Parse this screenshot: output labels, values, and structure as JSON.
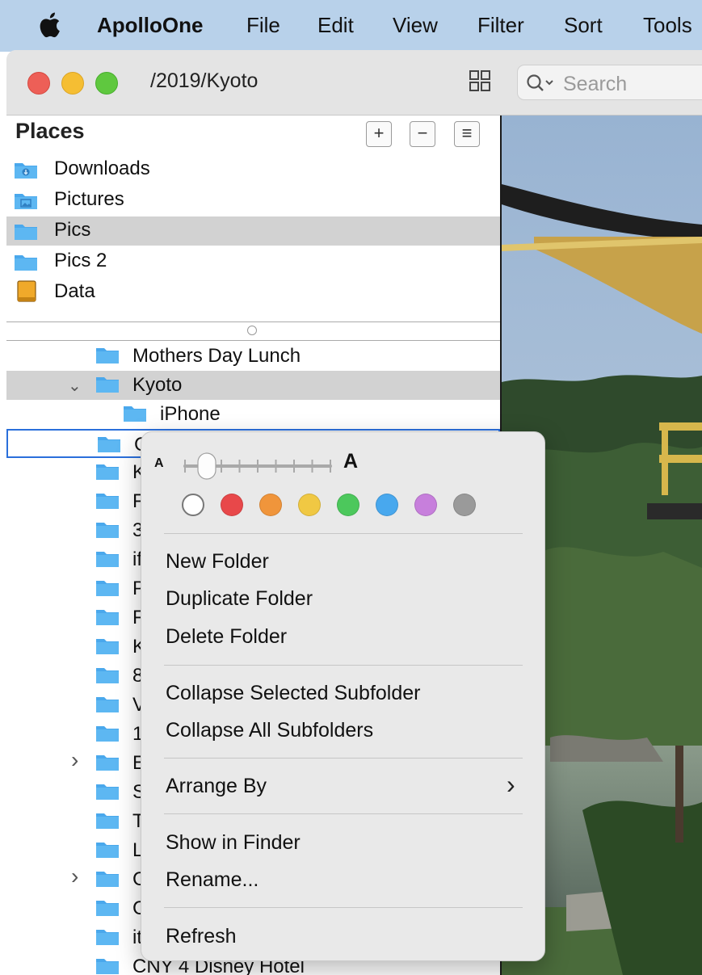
{
  "menubar": {
    "app_name": "ApolloOne",
    "items": [
      "File",
      "Edit",
      "View",
      "Filter",
      "Sort",
      "Tools"
    ]
  },
  "window": {
    "path": "/2019/Kyoto",
    "search_placeholder": "Search"
  },
  "places": {
    "title": "Places",
    "buttons": {
      "add": "+",
      "remove": "−",
      "list": "≡"
    },
    "items": [
      {
        "label": "Downloads",
        "icon": "downloads-folder-icon"
      },
      {
        "label": "Pictures",
        "icon": "pictures-folder-icon"
      },
      {
        "label": "Pics",
        "icon": "folder-icon",
        "selected": true
      },
      {
        "label": "Pics 2",
        "icon": "folder-icon"
      },
      {
        "label": "Data",
        "icon": "drive-icon"
      }
    ]
  },
  "tree": {
    "rows": [
      {
        "label": "Mothers Day Lunch"
      },
      {
        "label": "Kyoto",
        "expanded": true,
        "selected": true
      },
      {
        "label": "iPhone"
      },
      {
        "label": "C"
      },
      {
        "label": "K"
      },
      {
        "label": "F"
      },
      {
        "label": "3"
      },
      {
        "label": "if"
      },
      {
        "label": "P"
      },
      {
        "label": "F"
      },
      {
        "label": "K"
      },
      {
        "label": "8"
      },
      {
        "label": "V"
      },
      {
        "label": "1"
      },
      {
        "label": "E",
        "collapsed": true
      },
      {
        "label": "S"
      },
      {
        "label": "T"
      },
      {
        "label": "L"
      },
      {
        "label": "C",
        "collapsed": true
      },
      {
        "label": "C"
      },
      {
        "label": "it"
      },
      {
        "label": "CNY 4 Disney Hotel"
      }
    ]
  },
  "context_menu": {
    "text_size_small": "A",
    "text_size_large": "A",
    "text_size_level": 0.15,
    "tag_colors": [
      "#ffffff",
      "#e8484a",
      "#f0953b",
      "#f0c843",
      "#4cc85c",
      "#48a8ee",
      "#c77fdc",
      "#9a9a9a"
    ],
    "items": {
      "new_folder": "New Folder",
      "duplicate_folder": "Duplicate Folder",
      "delete_folder": "Delete Folder",
      "collapse_selected": "Collapse Selected Subfolder",
      "collapse_all": "Collapse All Subfolders",
      "arrange_by": "Arrange By",
      "arrange_by_arrow": "›",
      "show_in_finder": "Show in Finder",
      "rename": "Rename...",
      "refresh": "Refresh"
    }
  }
}
